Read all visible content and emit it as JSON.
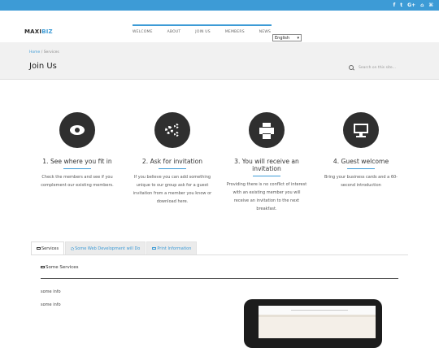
{
  "colors": {
    "accent": "#3d9bd6",
    "dark_circle": "#2f2f2f",
    "band": "#f1f1f1"
  },
  "topbar": {
    "social_icons": [
      {
        "name": "facebook-icon",
        "glyph": "f"
      },
      {
        "name": "twitter-icon",
        "glyph": "t"
      },
      {
        "name": "google-plus-icon",
        "glyph": "G+"
      },
      {
        "name": "github-icon",
        "glyph": "⌂"
      },
      {
        "name": "rss-icon",
        "glyph": "⌘"
      }
    ]
  },
  "header": {
    "logo_main": "MAXI",
    "logo_accent": "BIZ",
    "nav": [
      "WELCOME",
      "ABOUT",
      "JOIN US",
      "MEMBERS",
      "NEWS"
    ],
    "language": "English"
  },
  "titleband": {
    "breadcrumb_home": "Home",
    "breadcrumb_sep": "/",
    "breadcrumb_current": "Services",
    "title": "Join Us",
    "search_placeholder": "Search on this site..."
  },
  "steps": [
    {
      "icon": "eye-icon",
      "title": "1. See where you fit in",
      "text": "Check the members and see if you complement our existing members."
    },
    {
      "icon": "gears-icon",
      "title": "2. Ask for invitation",
      "text": "If you believe you can add something unique to our group ask for a guest invitation from a member you know or download here."
    },
    {
      "icon": "print-icon",
      "title": "3. You will receive an invitation",
      "text": "Providing there is no conflict of interest with an existing member you will receive an invitation to the next breakfast."
    },
    {
      "icon": "desktop-icon",
      "title": "4. Guest welcome",
      "text": "Bring your business cards and a 60-second introduction"
    }
  ],
  "tabs": {
    "items": [
      "Services",
      "Some Web Development will Do",
      "Print Information"
    ],
    "active_index": 0
  },
  "content": {
    "heading": "Some Services",
    "info": [
      "some info",
      "some info"
    ]
  }
}
